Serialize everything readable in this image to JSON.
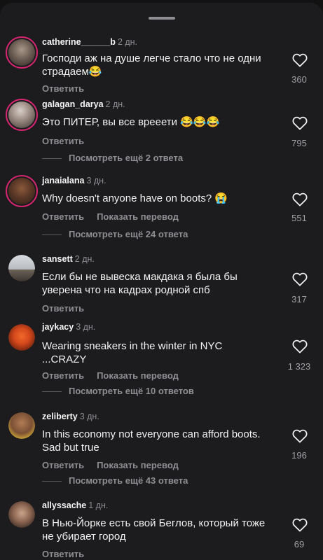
{
  "colors": {
    "background": "#1c1c1e",
    "accent_ring": "#d6256f",
    "muted": "#8e8e93"
  },
  "reply_label": "Ответить",
  "translate_label": "Показать перевод",
  "comments": [
    {
      "user": "catherine______b",
      "time": "2 дн.",
      "text": "Господи аж на душе легче стало что не одни страдаем😂",
      "likes": "360",
      "replies": ""
    },
    {
      "user": "galagan_darya",
      "time": "2 дн.",
      "text": "Это ПИТЕР, вы все врееети 😂😂😂",
      "likes": "795",
      "replies": "Посмотреть ещё 2 ответа"
    },
    {
      "user": "janaialana",
      "time": "3 дн.",
      "text": "Why doesn't anyone have on boots? 😭",
      "likes": "551",
      "replies": "Посмотреть ещё 24 ответа"
    },
    {
      "user": "sansett",
      "time": "2 дн.",
      "text": "Если бы не вывеска макдака я была бы уверена что на кадрах родной спб",
      "likes": "317",
      "replies": ""
    },
    {
      "user": "jaykacy",
      "time": "3 дн.",
      "text": "Wearing sneakers in the winter in NYC ...CRAZY",
      "likes": "1 323",
      "replies": "Посмотреть ещё 10 ответов"
    },
    {
      "user": "zeliberty",
      "time": "3 дн.",
      "text": "In this economy not everyone can afford boots. Sad but true",
      "likes": "196",
      "replies": "Посмотреть ещё 43 ответа"
    },
    {
      "user": "allyssache",
      "time": "1 дн.",
      "text": "В Нью-Йорке есть свой Беглов, который тоже не убирает город",
      "likes": "69",
      "replies": ""
    }
  ]
}
